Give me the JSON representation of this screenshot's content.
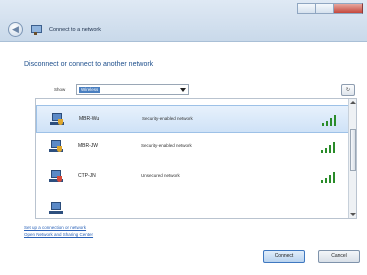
{
  "window": {
    "title": "Connect to a network"
  },
  "main": {
    "heading": "Disconnect or connect to another network",
    "show_label": "Show",
    "show_value": "Wireless",
    "refresh_icon": "refresh-icon"
  },
  "networks": [
    {
      "name": "MBR-Wu",
      "security": "Security-enabled network",
      "signal_bars": 4,
      "selected": true
    },
    {
      "name": "MBR-JW",
      "security": "Security-enabled network",
      "signal_bars": 4,
      "selected": false
    },
    {
      "name": "CTP-JN",
      "security": "Unsecured network",
      "signal_bars": 4,
      "selected": false
    }
  ],
  "links": {
    "setup": "Set up a connection or network",
    "network_center": "Open Network and Sharing Center"
  },
  "buttons": {
    "connect": "Connect",
    "cancel": "Cancel"
  },
  "colors": {
    "heading": "#1e4f8c",
    "link": "#2a62b8",
    "signal": "#2a8c2a",
    "selected_row": "#cfe2f7"
  }
}
